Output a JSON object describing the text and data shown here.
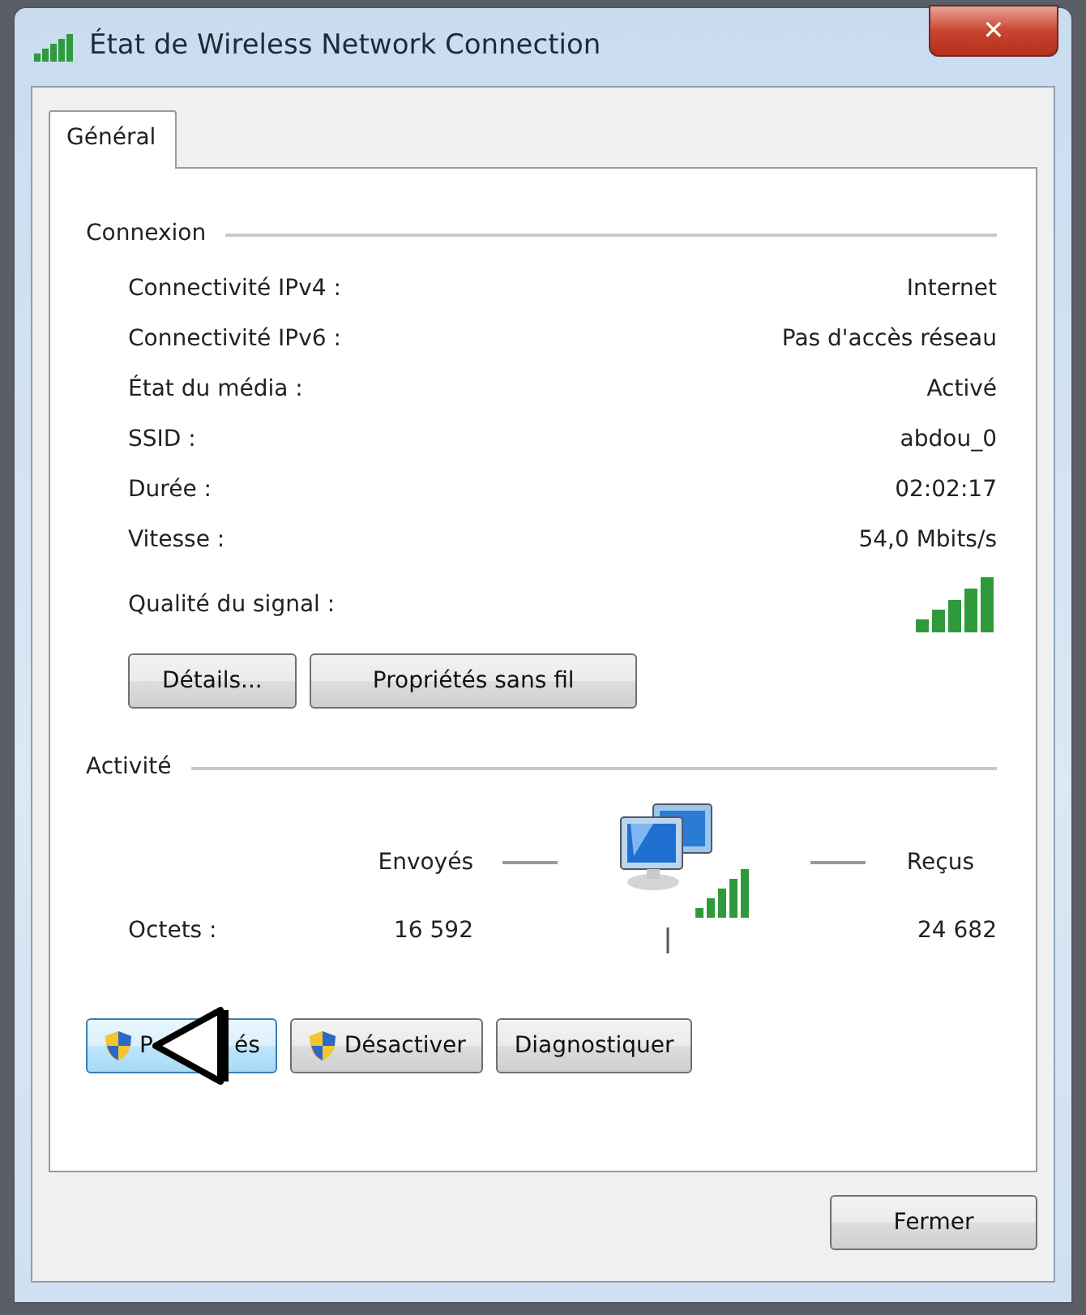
{
  "window": {
    "title": "État de Wireless Network Connection",
    "close": "✕"
  },
  "tabs": [
    {
      "label": "Général",
      "selected": true
    }
  ],
  "connection": {
    "heading": "Connexion",
    "rows": [
      {
        "label": "Connectivité IPv4 :",
        "value": "Internet"
      },
      {
        "label": "Connectivité IPv6 :",
        "value": "Pas d'accès réseau"
      },
      {
        "label": "État du média :",
        "value": "Activé"
      },
      {
        "label": "SSID :",
        "value": "abdou_0"
      },
      {
        "label": "Durée :",
        "value": "02:02:17"
      },
      {
        "label": "Vitesse :",
        "value": "54,0 Mbits/s"
      }
    ],
    "signal_label": "Qualité du signal :",
    "buttons": [
      {
        "label": "Détails..."
      },
      {
        "label": "Propriétés sans fil"
      }
    ]
  },
  "activity": {
    "heading": "Activité",
    "sent": "Envoyés",
    "received": "Reçus",
    "bytes_label": "Octets :",
    "bytes_sent": "16 592",
    "bytes_received": "24 682"
  },
  "buttons": [
    {
      "label_parts": [
        "P",
        "és"
      ],
      "shield": true,
      "hovered": true,
      "cursor": true
    },
    {
      "label_parts": [
        "Désactiver"
      ],
      "shield": true,
      "hovered": false
    },
    {
      "label_parts": [
        "Diagnostiquer"
      ],
      "hovered": false
    }
  ],
  "footer": {
    "close_button": "Fermer"
  }
}
